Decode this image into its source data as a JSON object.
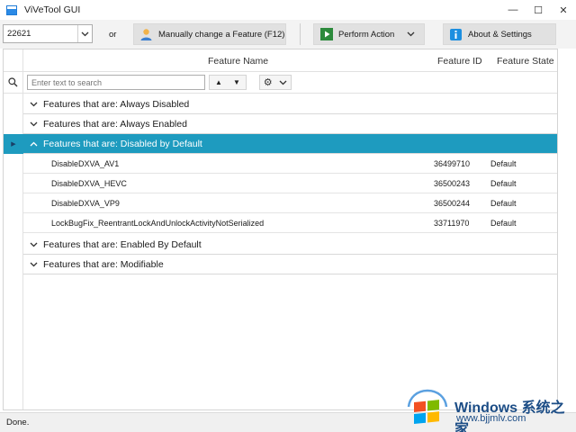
{
  "window": {
    "title": "ViVeTool GUI",
    "minimize": "—",
    "maximize": "☐",
    "close": "✕"
  },
  "toolbar": {
    "build_value": "22621",
    "or_label": "or",
    "manual_button": "Manually change a Feature (F12)",
    "perform_button": "Perform Action",
    "about_button": "About & Settings"
  },
  "grid": {
    "columns": [
      "Feature Name",
      "Feature ID",
      "Feature State"
    ],
    "search_placeholder": "Enter text to search",
    "groups": [
      {
        "label": "Features that are: Always Disabled"
      },
      {
        "label": "Features that are: Always Enabled"
      },
      {
        "label": "Features that are: Disabled by Default"
      },
      {
        "label": "Features that are: Enabled By Default"
      },
      {
        "label": "Features that are: Modifiable"
      }
    ],
    "rows": [
      {
        "name": "DisableDXVA_AV1",
        "id": "36499710",
        "state": "Default"
      },
      {
        "name": "DisableDXVA_HEVC",
        "id": "36500243",
        "state": "Default"
      },
      {
        "name": "DisableDXVA_VP9",
        "id": "36500244",
        "state": "Default"
      },
      {
        "name": "LockBugFix_ReentrantLockAndUnlockActivityNotSerialized",
        "id": "33711970",
        "state": "Default"
      }
    ]
  },
  "status": {
    "text": "Done."
  },
  "watermark": {
    "brand": "Windows 系统之家",
    "url": "www.bjjmlv.com"
  },
  "colors": {
    "selection": "#1e9bbf",
    "toolbar_bg": "#f3f3f3"
  }
}
